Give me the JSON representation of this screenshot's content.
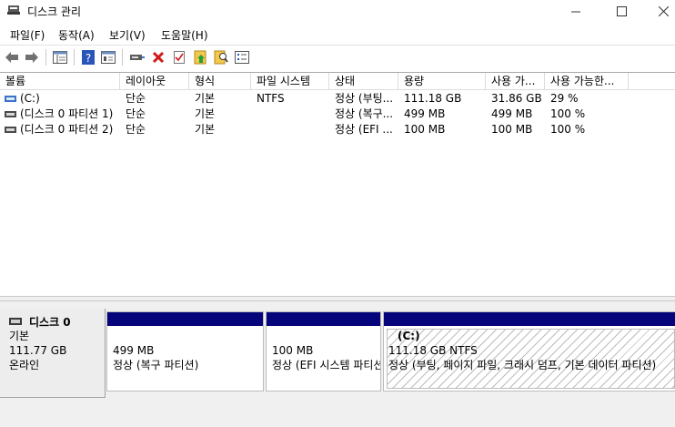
{
  "window": {
    "title": "디스크 관리",
    "minimize_glyph": "—",
    "maximize_glyph": "☐",
    "close_glyph": "✕"
  },
  "menu": {
    "items": [
      {
        "label": "파일(F)"
      },
      {
        "label": "동작(A)"
      },
      {
        "label": "보기(V)"
      },
      {
        "label": "도움말(H)"
      }
    ]
  },
  "toolbar": {
    "icons": [
      "back-arrow-icon",
      "forward-arrow-icon",
      "show-hide-console-tree-icon",
      "help-icon",
      "properties-icon",
      "connect-drive-icon",
      "delete-icon",
      "check-icon",
      "import-icon",
      "search-icon",
      "list-icon"
    ]
  },
  "columns": [
    "볼륨",
    "레이아웃",
    "형식",
    "파일 시스템",
    "상태",
    "용량",
    "사용 가...",
    "사용 가능한..."
  ],
  "volumes": [
    {
      "name": "(C:)",
      "layout": "단순",
      "type": "기본",
      "fs": "NTFS",
      "status": "정상 (부팅...",
      "capacity": "111.18 GB",
      "free": "31.86 GB",
      "free_pct": "29 %"
    },
    {
      "name": "(디스크 0 파티션 1)",
      "layout": "단순",
      "type": "기본",
      "fs": "",
      "status": "정상 (복구...",
      "capacity": "499 MB",
      "free": "499 MB",
      "free_pct": "100 %"
    },
    {
      "name": "(디스크 0 파티션 2)",
      "layout": "단순",
      "type": "기본",
      "fs": "",
      "status": "정상 (EFI ...",
      "capacity": "100 MB",
      "free": "100 MB",
      "free_pct": "100 %"
    }
  ],
  "disk": {
    "name": "디스크 0",
    "type": "기본",
    "size": "111.77 GB",
    "state": "온라인",
    "partitions": [
      {
        "title": "",
        "size": "499 MB",
        "status": "정상 (복구 파티션)"
      },
      {
        "title": "",
        "size": "100 MB",
        "status": "정상 (EFI 시스템 파티션)"
      },
      {
        "title": "(C:)",
        "size": "111.18 GB NTFS",
        "status": "정상 (부팅, 페이지 파일, 크래시 덤프, 기본 데이터 파티션)"
      }
    ]
  },
  "colors": {
    "partition_bar": "#06047a",
    "selected_hatch": "#bcbcbc"
  }
}
